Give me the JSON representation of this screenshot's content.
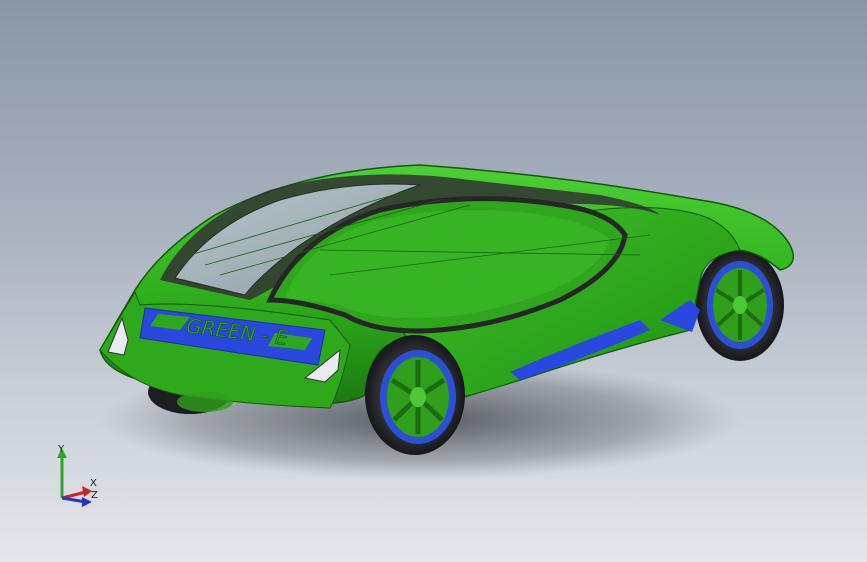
{
  "viewport": {
    "background_top": "#8b96a7",
    "background_bottom": "#e4e7eb"
  },
  "model": {
    "name_plate_text": "GREEN - E",
    "body_color": "#2fae1d",
    "body_dark": "#1d7d10",
    "accent_color": "#2a47e0",
    "glass_color": "#9fb0b8"
  },
  "triad": {
    "y_label": "Y",
    "x_label": "X",
    "z_label": "Z",
    "y_color": "#2ea32e",
    "x_color": "#d02020",
    "z_color": "#2233cc"
  }
}
